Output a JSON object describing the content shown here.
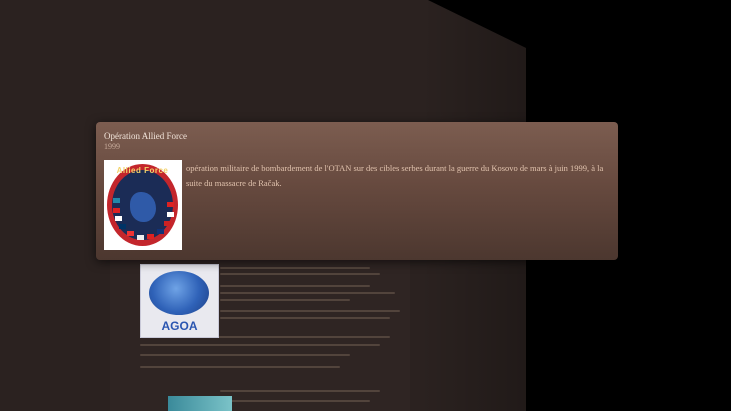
{
  "popup": {
    "title": "Opération Allied Force",
    "year": "1999",
    "description": "opération militaire de bombardement de l'OTAN sur des cibles serbes durant la guerre du Kosovo de mars à juin 1999, à la suite du massacre de Račak.",
    "image_icon": "allied-force-patch",
    "image_patch_text": "Allied Force"
  },
  "background": {
    "thumbnail_icon": "agoa-logo",
    "thumbnail_text": "AGOA"
  },
  "colors": {
    "wall": "#2b2220",
    "popup_top": "#7c5d50",
    "popup_bottom": "#4c372f",
    "popup_title": "#f1e4da",
    "popup_text": "#e0c2ad"
  }
}
